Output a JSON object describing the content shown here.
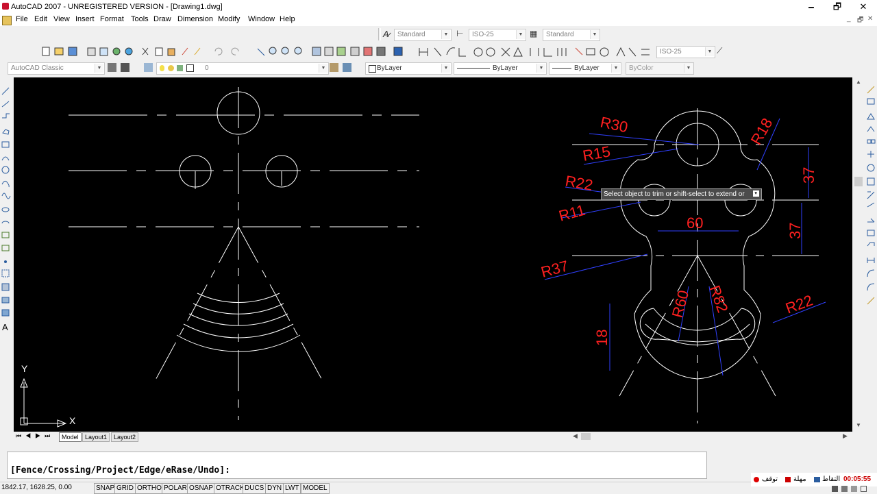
{
  "window": {
    "title": "AutoCAD 2007 - UNREGISTERED VERSION - [Drawing1.dwg]",
    "controls": [
      "🗕",
      "🗗",
      "✕"
    ],
    "mdi_controls": [
      "_",
      "🗗",
      "✕"
    ]
  },
  "menu": [
    "File",
    "Edit",
    "View",
    "Insert",
    "Format",
    "Tools",
    "Draw",
    "Dimension",
    "Modify",
    "Window",
    "Help"
  ],
  "styles_toolbar": {
    "text_style": "Standard",
    "dim_style": "ISO-25",
    "table_style": "Standard"
  },
  "dimension_toolbar": {
    "dim_style": "ISO-25"
  },
  "workspace": {
    "name": "AutoCAD Classic"
  },
  "layers": {
    "current": "0"
  },
  "properties": {
    "color": "ByLayer",
    "linetype": "ByLayer",
    "lineweight": "ByLayer",
    "plotstyle": "ByColor"
  },
  "drawing": {
    "dimension_labels": [
      "R30",
      "R15",
      "R22",
      "R11",
      "R37",
      "R18",
      "37",
      "37",
      "60",
      "R60",
      "R82",
      "R22",
      "18"
    ],
    "ucs": {
      "x_label": "X",
      "y_label": "Y"
    }
  },
  "tooltip": "Select object to trim or shift-select to extend or",
  "layout_tabs": [
    "Model",
    "Layout1",
    "Layout2"
  ],
  "command_line": "[Fence/Crossing/Project/Edge/eRase/Undo]:",
  "status": {
    "coordinates": "1842.17, 1628.25, 0.00",
    "toggles": [
      "SNAP",
      "GRID",
      "ORTHO",
      "POLAR",
      "OSNAP",
      "OTRACK",
      "DUCS",
      "DYN",
      "LWT",
      "MODEL"
    ]
  },
  "recorder": {
    "time": "00:05:55",
    "capture_label": "التقاط",
    "pause_label": "مهلة",
    "stop_label": "توقف"
  },
  "colors": {
    "canvas": "#000000",
    "geometry": "#ffffff",
    "dimension_text": "#ff2020",
    "dimension_line": "#3040ff"
  }
}
